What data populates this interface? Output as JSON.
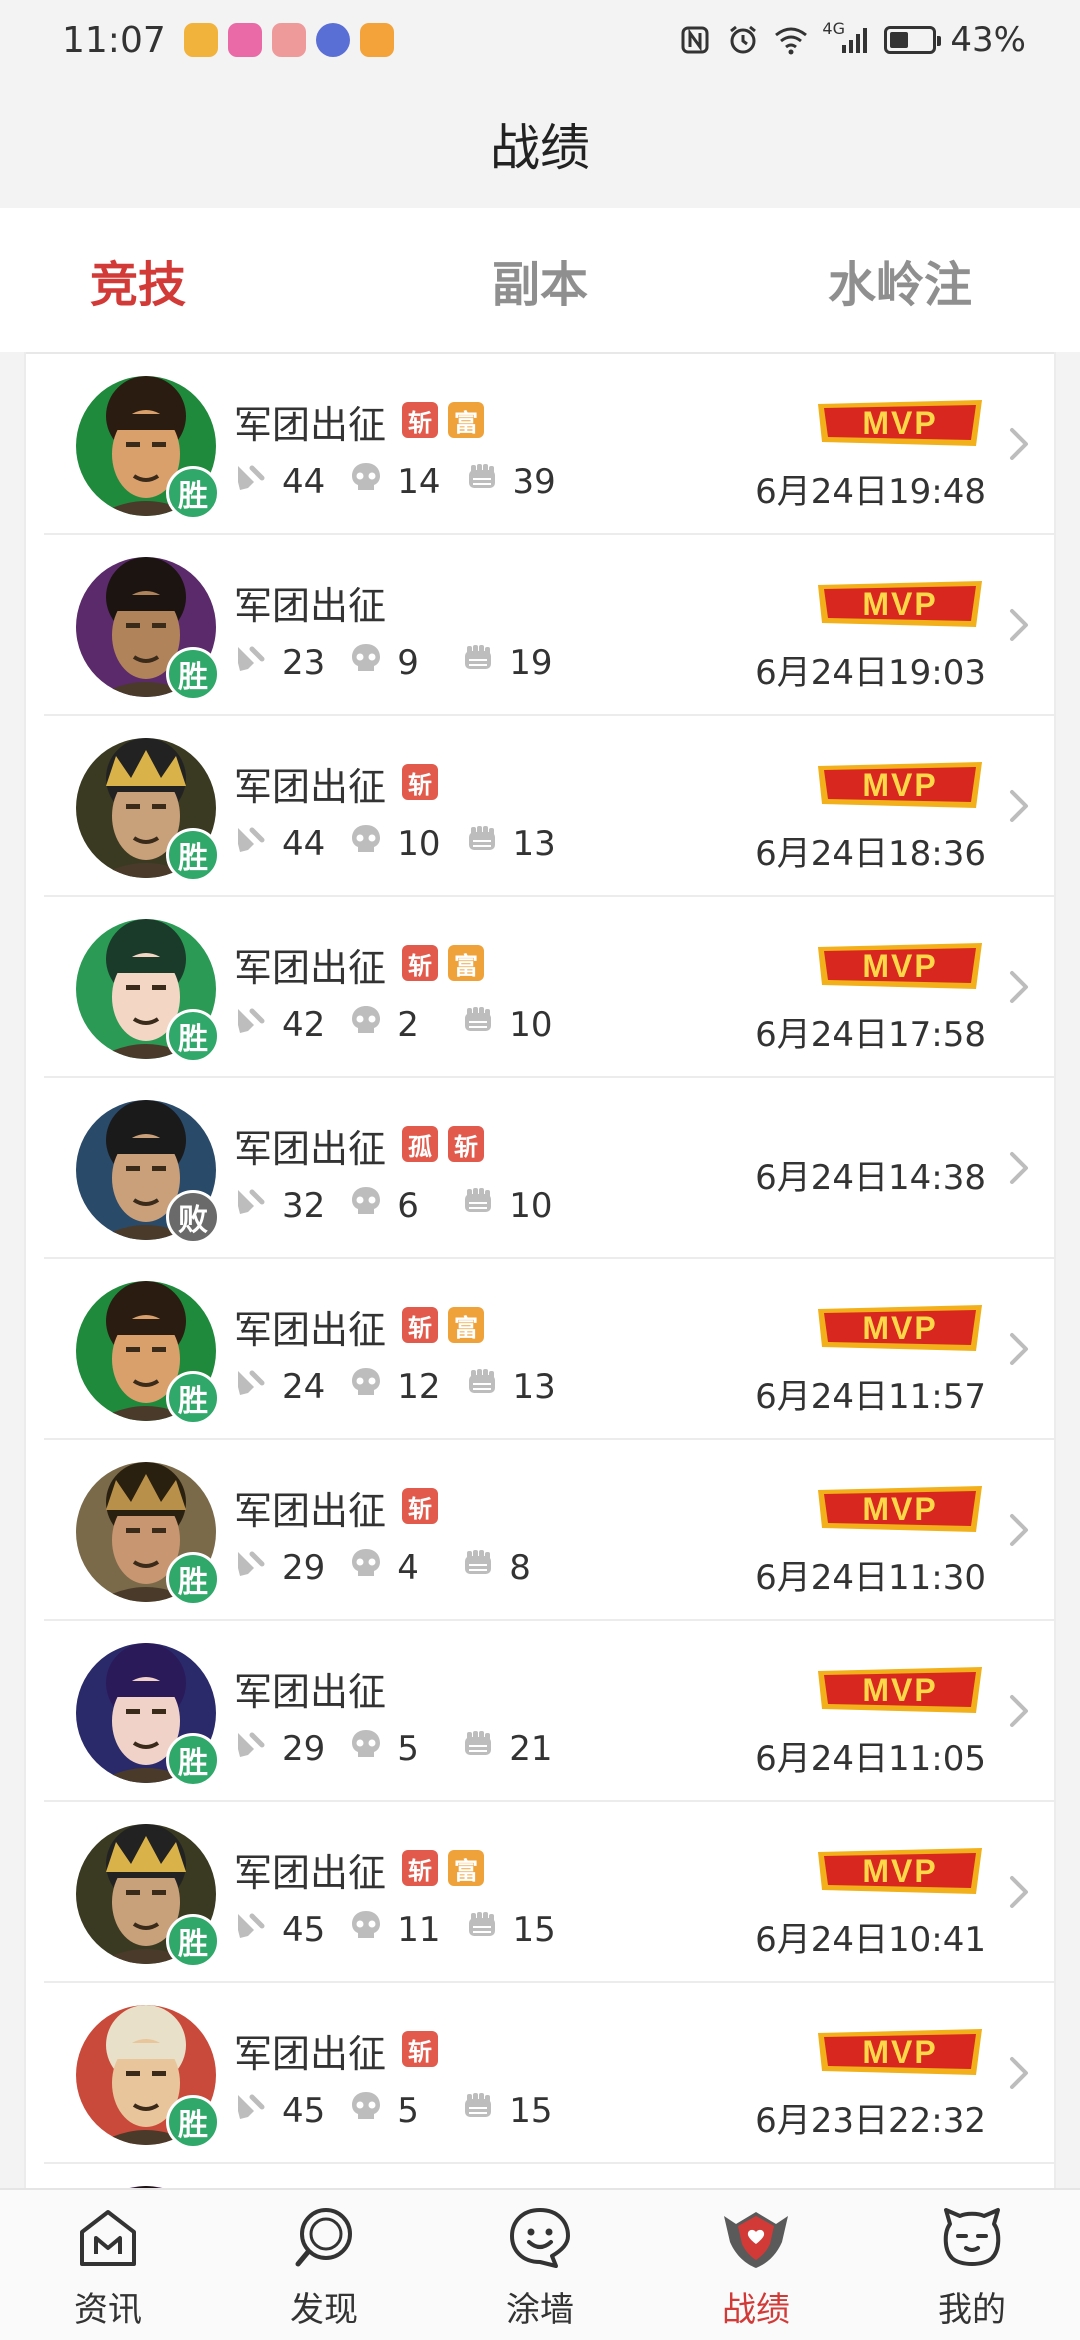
{
  "status_bar": {
    "time": "11:07",
    "network": "4G",
    "battery_percent": "43%",
    "battery_level": 0.43
  },
  "header": {
    "title": "战绩"
  },
  "tabs": [
    {
      "label": "竞技",
      "active": true
    },
    {
      "label": "副本",
      "active": false
    },
    {
      "label": "水岭注",
      "active": false
    }
  ],
  "records": [
    {
      "mode": "军团出征",
      "tags": [
        "斩",
        "富"
      ],
      "kills": "44",
      "deaths": "14",
      "assists": "39",
      "result": "胜",
      "mvp": true,
      "date": "6月24日19:48"
    },
    {
      "mode": "军团出征",
      "tags": [],
      "kills": "23",
      "deaths": "9",
      "assists": "19",
      "result": "胜",
      "mvp": true,
      "date": "6月24日19:03"
    },
    {
      "mode": "军团出征",
      "tags": [
        "斩"
      ],
      "kills": "44",
      "deaths": "10",
      "assists": "13",
      "result": "胜",
      "mvp": true,
      "date": "6月24日18:36"
    },
    {
      "mode": "军团出征",
      "tags": [
        "斩",
        "富"
      ],
      "kills": "42",
      "deaths": "2",
      "assists": "10",
      "result": "胜",
      "mvp": true,
      "date": "6月24日17:58"
    },
    {
      "mode": "军团出征",
      "tags": [
        "孤",
        "斩"
      ],
      "kills": "32",
      "deaths": "6",
      "assists": "10",
      "result": "败",
      "mvp": false,
      "date": "6月24日14:38"
    },
    {
      "mode": "军团出征",
      "tags": [
        "斩",
        "富"
      ],
      "kills": "24",
      "deaths": "12",
      "assists": "13",
      "result": "胜",
      "mvp": true,
      "date": "6月24日11:57"
    },
    {
      "mode": "军团出征",
      "tags": [
        "斩"
      ],
      "kills": "29",
      "deaths": "4",
      "assists": "8",
      "result": "胜",
      "mvp": true,
      "date": "6月24日11:30"
    },
    {
      "mode": "军团出征",
      "tags": [],
      "kills": "29",
      "deaths": "5",
      "assists": "21",
      "result": "胜",
      "mvp": true,
      "date": "6月24日11:05"
    },
    {
      "mode": "军团出征",
      "tags": [
        "斩",
        "富"
      ],
      "kills": "45",
      "deaths": "11",
      "assists": "15",
      "result": "胜",
      "mvp": true,
      "date": "6月24日10:41"
    },
    {
      "mode": "军团出征",
      "tags": [
        "斩"
      ],
      "kills": "45",
      "deaths": "5",
      "assists": "15",
      "result": "胜",
      "mvp": true,
      "date": "6月23日22:32"
    }
  ],
  "mvp_label": "MVP",
  "bottom_nav": [
    {
      "label": "资讯",
      "icon": "news-icon",
      "active": false
    },
    {
      "label": "发现",
      "icon": "discover-icon",
      "active": false
    },
    {
      "label": "涂墙",
      "icon": "graffiti-icon",
      "active": false
    },
    {
      "label": "战绩",
      "icon": "record-shield-icon",
      "active": true
    },
    {
      "label": "我的",
      "icon": "profile-icon",
      "active": false
    }
  ],
  "colors": {
    "accent": "#d23a37",
    "win": "#2fa86a",
    "lose": "#6a6a6a",
    "tag_red": "#e15a4c",
    "tag_orange": "#f0a23a"
  }
}
